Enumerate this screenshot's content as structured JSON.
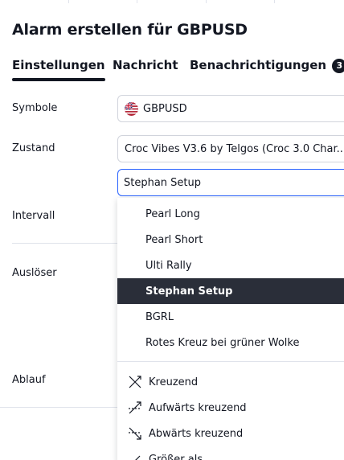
{
  "dialog": {
    "title": "Alarm erstellen für GBPUSD"
  },
  "tabs": [
    {
      "label": "Einstellungen",
      "active": true
    },
    {
      "label": "Nachricht",
      "active": false
    },
    {
      "label": "Benachrichtigungen",
      "badge": "3",
      "active": false
    }
  ],
  "form": {
    "symbol": {
      "label": "Symbole",
      "value": "GBPUSD",
      "icon": "gb-us-flag-icon"
    },
    "condition": {
      "label": "Zustand",
      "value": "Croc Vibes V3.6 by Telgos (Croc 3.0 Char..."
    },
    "plot_select": {
      "value": "Stephan Setup"
    },
    "interval": {
      "label": "Intervall"
    },
    "trigger": {
      "label": "Auslöser"
    },
    "expiry": {
      "label": "Ablauf"
    }
  },
  "dropdown": {
    "items": [
      {
        "label": "Pearl Long",
        "selected": false
      },
      {
        "label": "Pearl Short",
        "selected": false
      },
      {
        "label": "Ulti Rally",
        "selected": false
      },
      {
        "label": "Stephan Setup",
        "selected": true
      },
      {
        "label": "BGRL",
        "selected": false
      },
      {
        "label": "Rotes Kreuz bei grüner Wolke",
        "selected": false
      }
    ],
    "conditions": [
      {
        "label": "Kreuzend",
        "icon": "crossing-icon"
      },
      {
        "label": "Aufwärts kreuzend",
        "icon": "crossing-up-icon"
      },
      {
        "label": "Abwärts kreuzend",
        "icon": "crossing-down-icon"
      },
      {
        "label": "Größer als",
        "icon": "greater-than-icon"
      }
    ]
  },
  "colors": {
    "accent": "#2962ff",
    "selected_bg": "#2a2e39",
    "text": "#131722",
    "border": "#d1d4dc"
  }
}
